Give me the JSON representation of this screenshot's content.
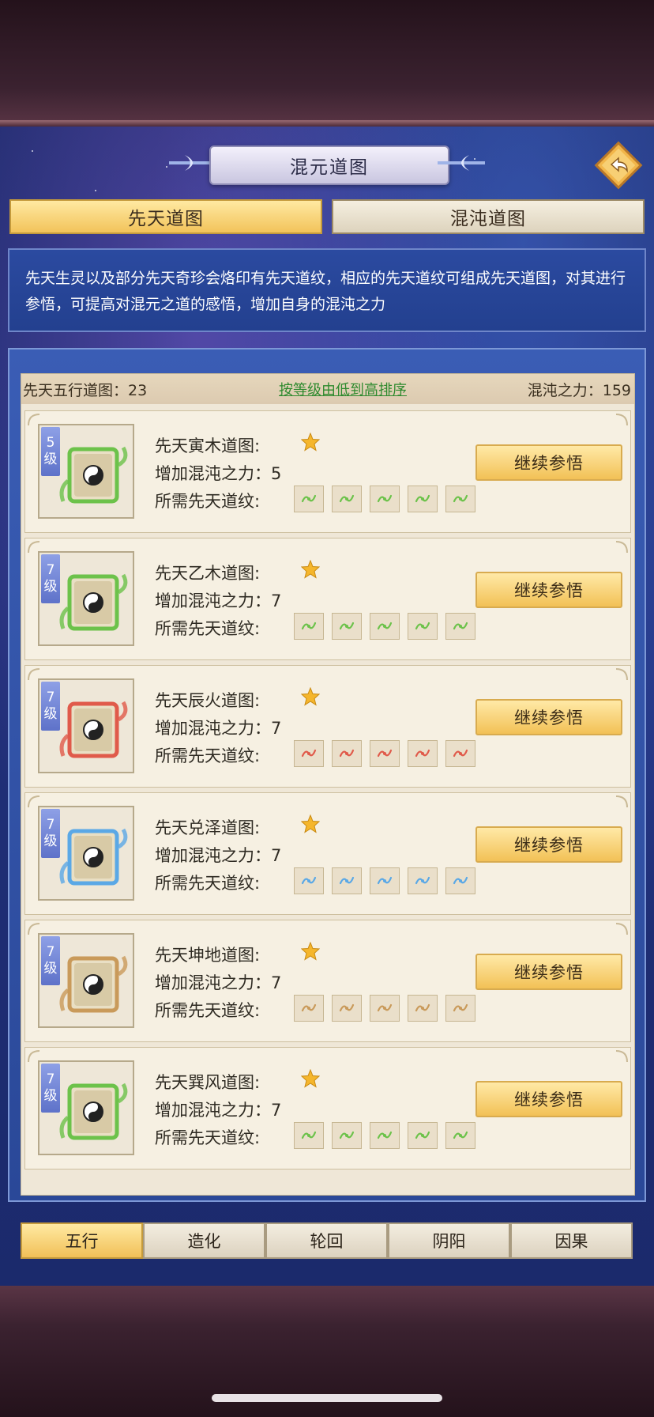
{
  "title": "混元道图",
  "main_tabs": [
    {
      "label": "先天道图",
      "active": true
    },
    {
      "label": "混沌道图",
      "active": false
    }
  ],
  "description": "先天生灵以及部分先天奇珍会烙印有先天道纹，相应的先天道纹可组成先天道图，对其进行参悟，可提高对混元之道的感悟，增加自身的混沌之力",
  "stats": {
    "count_label": "先天五行道图：23",
    "sort_label": "按等级由低到高排序",
    "power_label": "混沌之力：159"
  },
  "cards": [
    {
      "level": "5",
      "level_unit": "级",
      "name": "先天寅木道图:",
      "power": "增加混沌之力：5",
      "req": "所需先天道纹:",
      "button": "继续参悟",
      "stars": 1,
      "color": "#6cc24a"
    },
    {
      "level": "7",
      "level_unit": "级",
      "name": "先天乙木道图:",
      "power": "增加混沌之力：7",
      "req": "所需先天道纹:",
      "button": "继续参悟",
      "stars": 1,
      "color": "#6cc24a"
    },
    {
      "level": "7",
      "level_unit": "级",
      "name": "先天辰火道图:",
      "power": "增加混沌之力：7",
      "req": "所需先天道纹:",
      "button": "继续参悟",
      "stars": 1,
      "color": "#e05a4a"
    },
    {
      "level": "7",
      "level_unit": "级",
      "name": "先天兑泽道图:",
      "power": "增加混沌之力：7",
      "req": "所需先天道纹:",
      "button": "继续参悟",
      "stars": 1,
      "color": "#5aa8e6"
    },
    {
      "level": "7",
      "level_unit": "级",
      "name": "先天坤地道图:",
      "power": "增加混沌之力：7",
      "req": "所需先天道纹:",
      "button": "继续参悟",
      "stars": 1,
      "color": "#c99a5a"
    },
    {
      "level": "7",
      "level_unit": "级",
      "name": "先天巽风道图:",
      "power": "增加混沌之力：7",
      "req": "所需先天道纹:",
      "button": "继续参悟",
      "stars": 1,
      "color": "#6cc24a"
    }
  ],
  "bottom_tabs": [
    {
      "label": "五行",
      "active": true
    },
    {
      "label": "造化",
      "active": false
    },
    {
      "label": "轮回",
      "active": false
    },
    {
      "label": "阴阳",
      "active": false
    },
    {
      "label": "因果",
      "active": false
    }
  ],
  "colors": {
    "accent_gold": "#f2c35a",
    "panel_blue": "#2a4898",
    "link_green": "#2e8a2e"
  }
}
